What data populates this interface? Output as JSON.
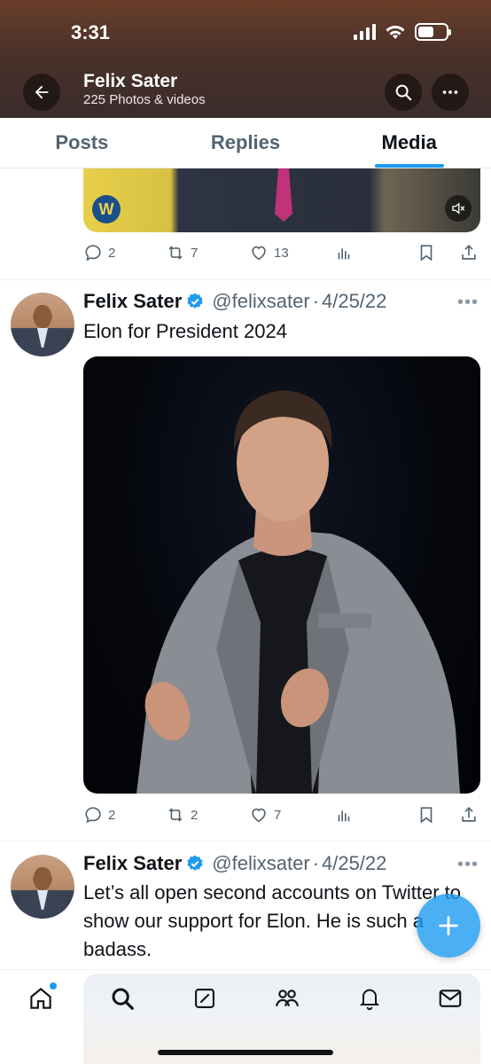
{
  "status_bar": {
    "time": "3:31"
  },
  "header": {
    "title": "Felix Sater",
    "subtitle": "225 Photos & videos",
    "back_icon": "arrow-left-icon",
    "search_icon": "search-icon",
    "more_icon": "more-horizontal-icon"
  },
  "tabs": [
    {
      "label": "Posts",
      "active": false
    },
    {
      "label": "Replies",
      "active": false
    },
    {
      "label": "Media",
      "active": true
    }
  ],
  "prev_post": {
    "replies": "2",
    "reposts": "7",
    "likes": "13"
  },
  "tweets": [
    {
      "name": "Felix Sater",
      "handle": "@felixsater",
      "separator": "·",
      "date": "4/25/22",
      "text": "Elon for President 2024",
      "replies": "2",
      "reposts": "2",
      "likes": "7"
    },
    {
      "name": "Felix Sater",
      "handle": "@felixsater",
      "separator": "·",
      "date": "4/25/22",
      "text": "Let’s all open second accounts on Twitter to show our support for Elon. He is such a badass."
    }
  ],
  "colors": {
    "accent": "#1d9bf0",
    "text_primary": "#0f1419",
    "text_secondary": "#536471"
  },
  "bottom_nav": [
    "home-icon",
    "search-icon",
    "grok-icon",
    "communities-icon",
    "notifications-icon",
    "messages-icon"
  ]
}
